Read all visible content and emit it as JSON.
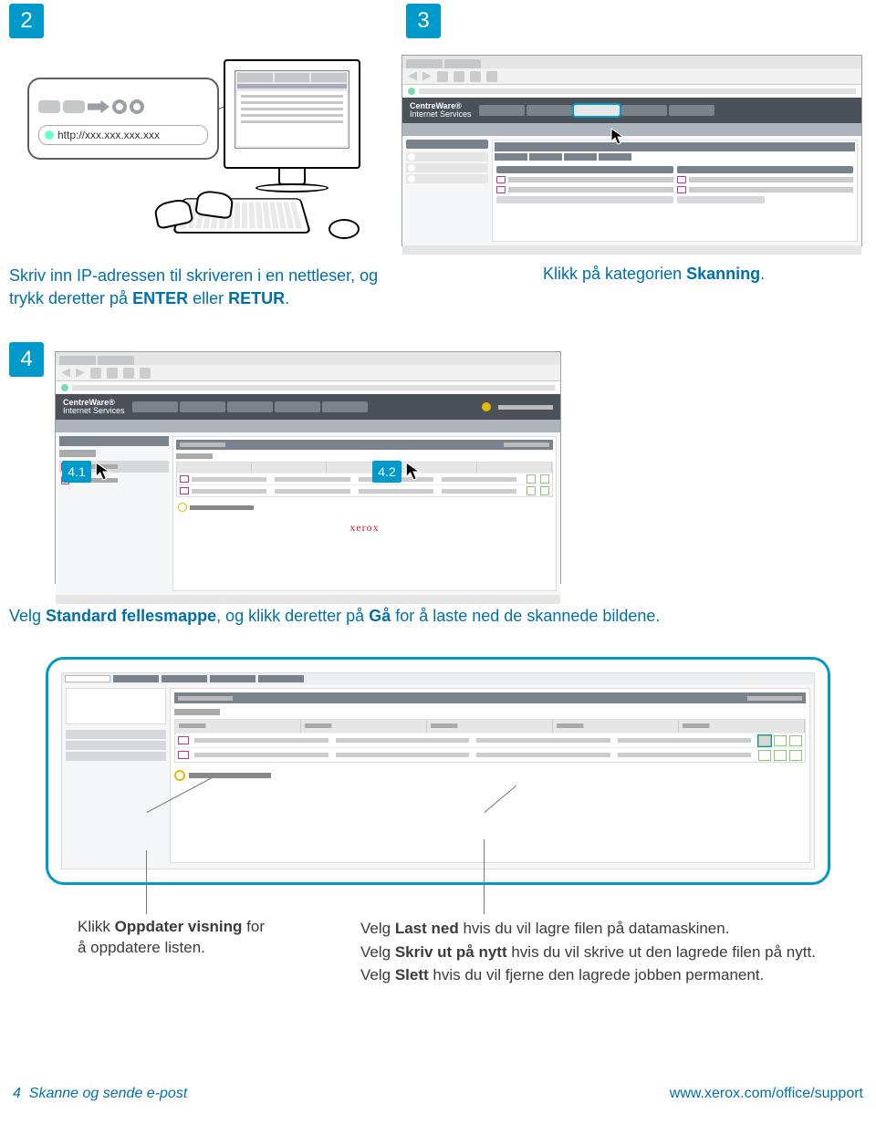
{
  "steps": {
    "s2": "2",
    "s3": "3",
    "s4": "4",
    "s41": "4.1",
    "s42": "4.2"
  },
  "url_example": "http://xxx.xxx.xxx.xxx",
  "centreware": {
    "line1": "CentreWare®",
    "line2": "Internet Services"
  },
  "logo4": "xerox",
  "instructions": {
    "step2_a": "Skriv inn IP-adressen til skriveren i en nettleser, og trykk deretter på ",
    "step2_b": "ENTER",
    "step2_c": " eller ",
    "step2_d": "RETUR",
    "step2_e": ".",
    "step3_a": "Klikk på kategorien ",
    "step3_b": "Skanning",
    "step3_c": ".",
    "step4_a": "Velg ",
    "step4_b": "Standard fellesmappe",
    "step4_c": ", og klikk deretter på ",
    "step4_d": "Gå",
    "step4_e": " for å laste ned de skannede bildene.",
    "refresh_a": "Klikk ",
    "refresh_b": "Oppdater visning",
    "refresh_c": " for å oppdatere listen.",
    "acts_1a": "Velg ",
    "acts_1b": "Last ned",
    "acts_1c": " hvis du vil lagre filen på datamaskinen.",
    "acts_2a": "Velg ",
    "acts_2b": "Skriv ut på nytt",
    "acts_2c": " hvis du vil skrive ut den lagrede filen på nytt.",
    "acts_3a": "Velg ",
    "acts_3b": "Slett",
    "acts_3c": " hvis du vil fjerne den lagrede jobben permanent."
  },
  "footer": {
    "page": "4",
    "title": "Skanne og sende e-post",
    "url": "www.xerox.com/office/support"
  }
}
